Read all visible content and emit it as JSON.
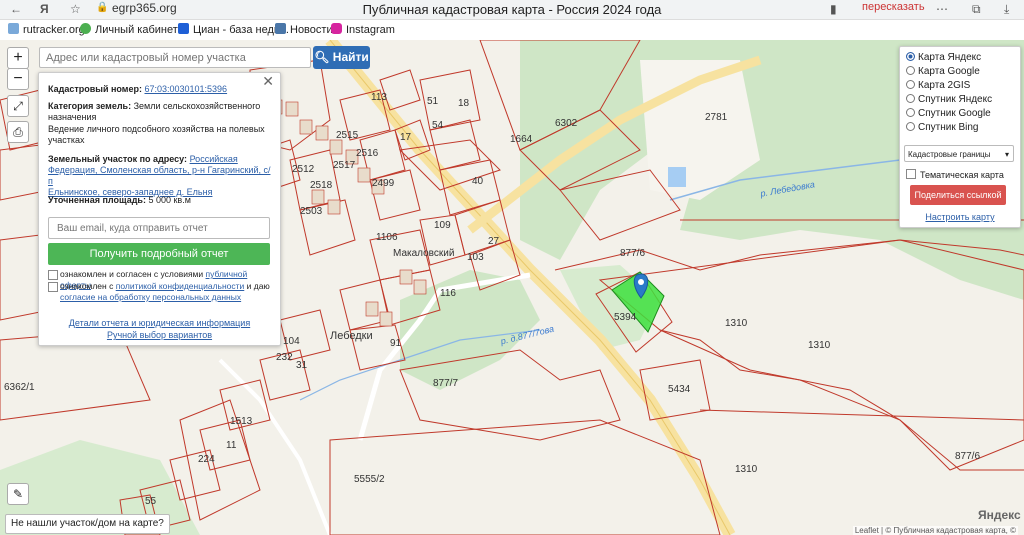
{
  "browser": {
    "url": "egrp365.org",
    "title": "Публичная кадастровая карта - Россия 2024 года",
    "translate": "пересказать",
    "bookmarks": [
      "rutracker.org",
      "Личный кабинет",
      "Циан - база недв...",
      "Новости",
      "Instagram"
    ]
  },
  "search": {
    "placeholder": "Адрес или кадастровый номер участка",
    "button": "Найти"
  },
  "info": {
    "cadastral_label": "Кадастровый номер:",
    "cadastral_number": "67:03:0030101:5396",
    "category_label": "Категория земель:",
    "category_value": "Земли сельскохозяйственного назначения",
    "usage": "Ведение личного подсобного хозяйства на полевых участках",
    "address_label": "Земельный участок по адресу:",
    "address_line1": "Российская",
    "address_line2": "Федерация, Смоленская область, р-н Гагаринский, с/п",
    "address_line3": "Ельнинское, северо-западнее д. Ельня",
    "area_label": "Уточненная площадь:",
    "area_value": "5 000 кв.м",
    "email_placeholder": "Ваш email, куда отправить отчет",
    "report_button": "Получить подробный отчет",
    "agree1_prefix": "ознакомлен и согласен с условиями",
    "agree1_link": "публичной оферты",
    "agree2_prefix": "ознакомлен с",
    "agree2_link1": "политикой конфиденциальности",
    "agree2_mid": "и даю",
    "agree2_link2": "согласие на обработку персональных данных",
    "details_link": "Детали отчета и юридическая информация",
    "manual_link": "Ручной выбор вариантов"
  },
  "layers": {
    "options": [
      "Карта Яндекс",
      "Карта Google",
      "Карта 2GIS",
      "Спутник Яндекс",
      "Спутник Google",
      "Спутник Bing"
    ],
    "selected_index": 0,
    "select_value": "Кадастровые границы",
    "thematic": "Тематическая карта",
    "share": "Поделиться ссылкой",
    "setup": "Настроить карту"
  },
  "map": {
    "places": [
      "Макаловский",
      "Лебедки"
    ],
    "rivers": [
      "р. Лебедовка",
      "р. д.877/7ова"
    ],
    "parcel_labels": [
      "2781",
      "1664",
      "6302",
      "877/6",
      "5394",
      "1310",
      "1310",
      "5434",
      "1310",
      "877/6",
      "877/7",
      "5555/2",
      "6362/1",
      "55",
      "51",
      "18",
      "54",
      "17",
      "113",
      "40",
      "27",
      "103",
      "116",
      "91",
      "104",
      "232",
      "31",
      "1513",
      "11",
      "224",
      "2517",
      "2512",
      "2518",
      "2515",
      "2516",
      "2499",
      "2503",
      "109",
      "1106"
    ],
    "not_found": "Не нашли участок/дом на карте?",
    "attribution": "Leaflet | © Публичная кадастровая карта, ©",
    "yandex": "Яндекс"
  }
}
